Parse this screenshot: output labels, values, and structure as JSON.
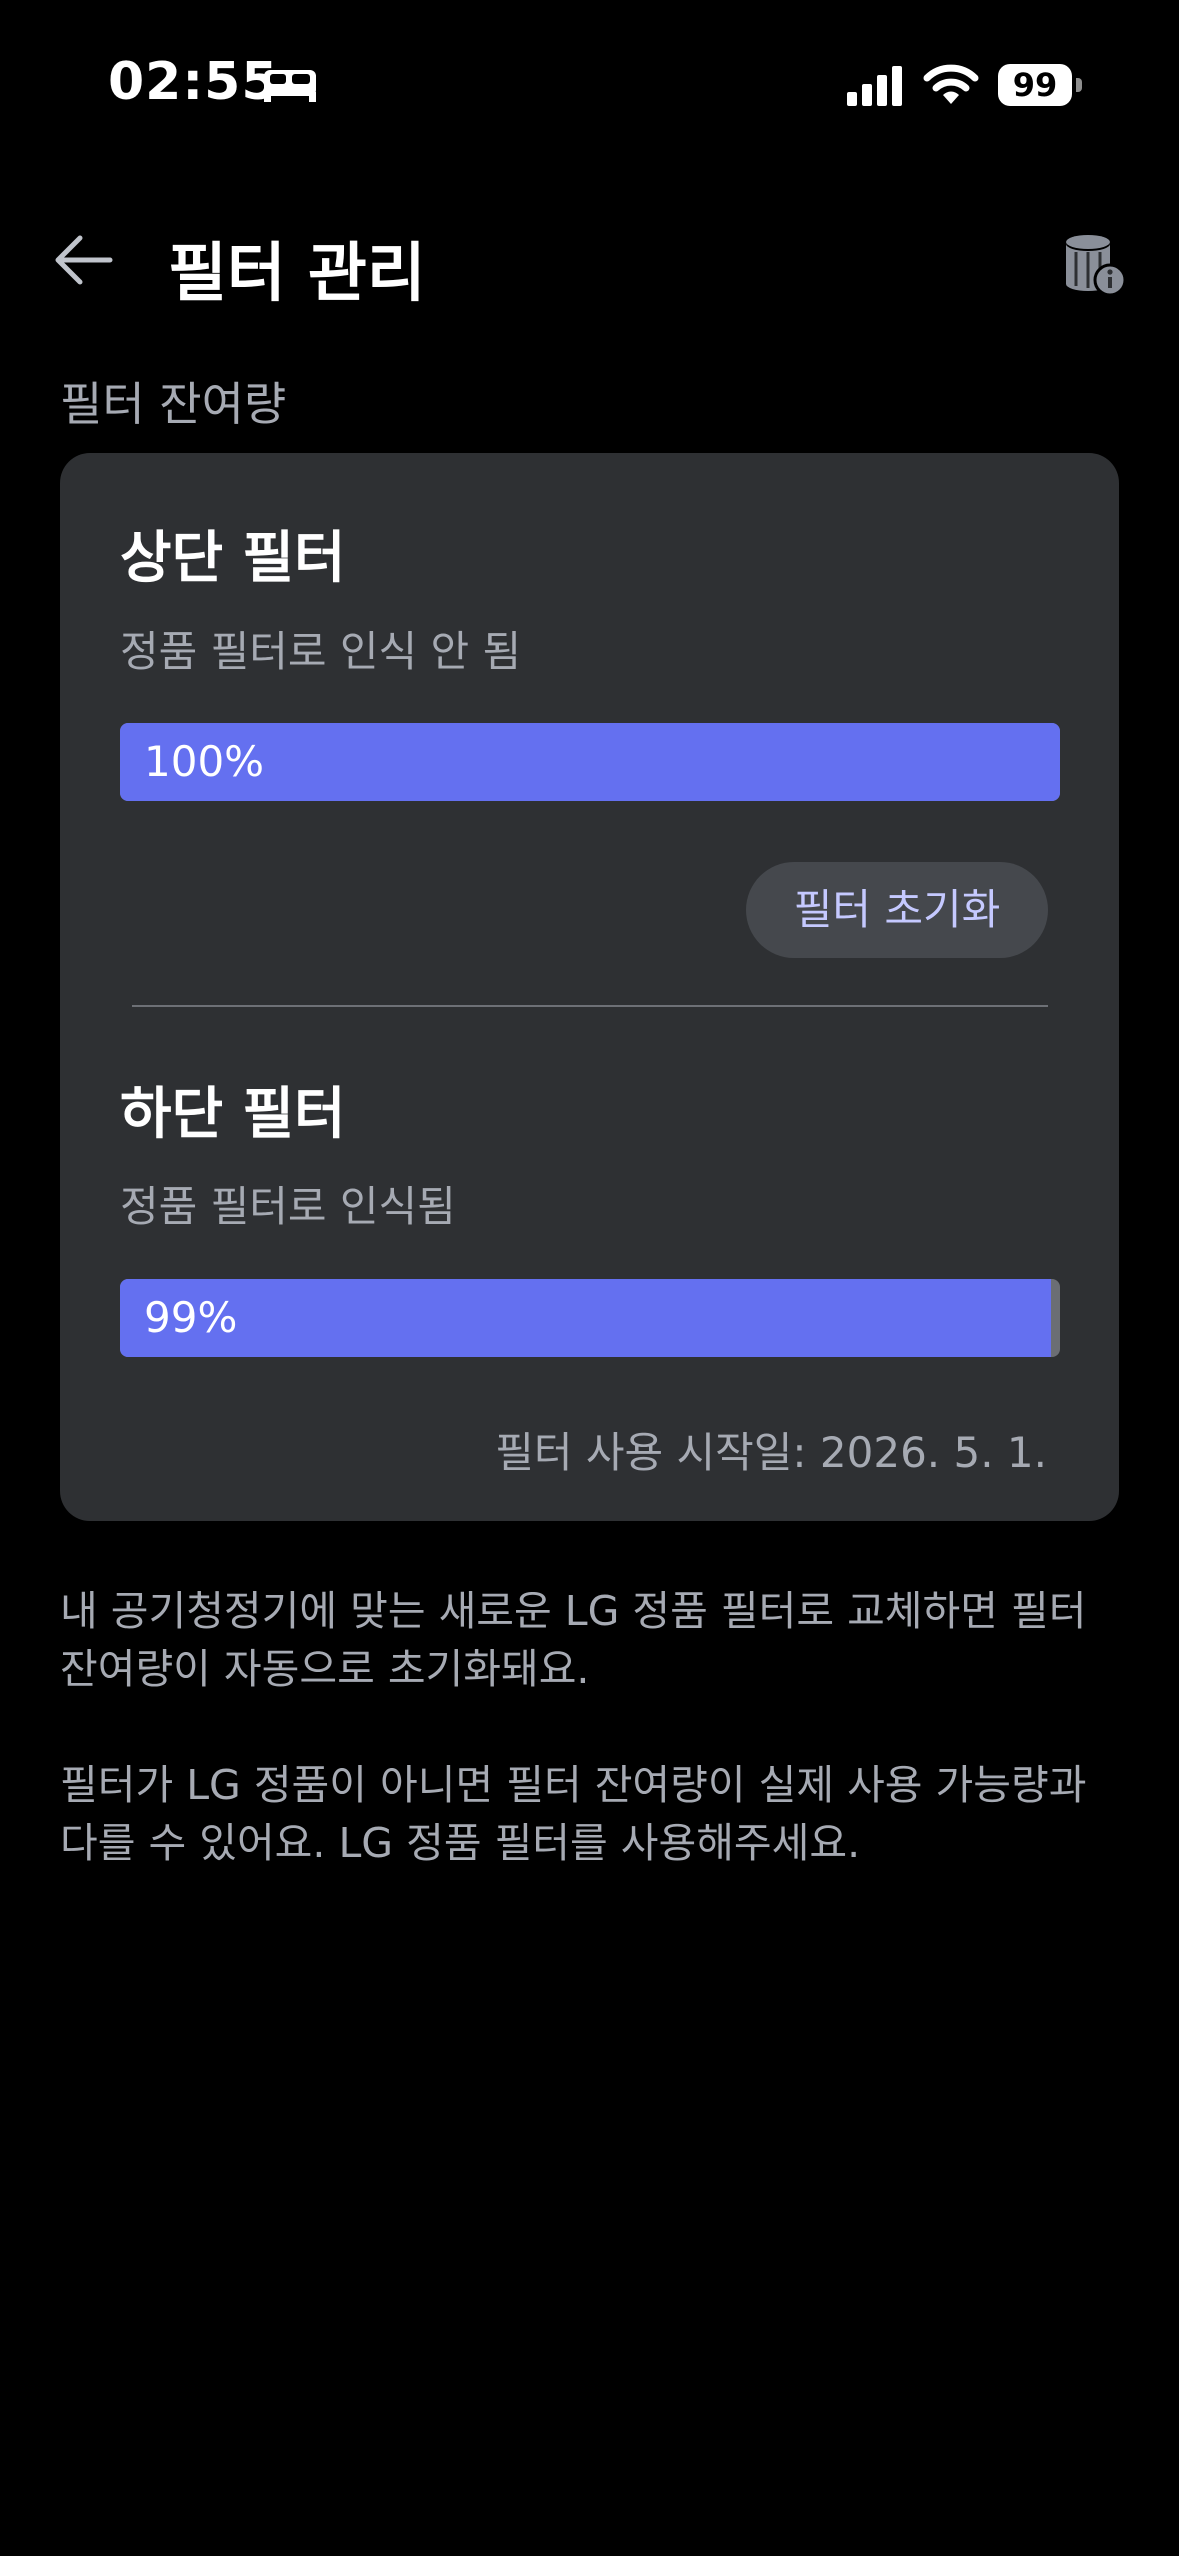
{
  "status_bar": {
    "time": "02:55",
    "battery_level": "99",
    "icons": [
      "sleep-mode-icon",
      "signal-icon",
      "wifi-icon",
      "battery-icon"
    ]
  },
  "header": {
    "back_icon": "back-arrow-icon",
    "title": "필터 관리",
    "info_icon": "filter-info-icon"
  },
  "section": {
    "label": "필터 잔여량"
  },
  "filters": [
    {
      "title": "상단 필터",
      "status": "정품 필터로 인식 안 됨",
      "percent_label": "100%",
      "remaining_fraction": 1.0,
      "reset_label": "필터 초기화"
    },
    {
      "title": "하단 필터",
      "status": "정품 필터로 인식됨",
      "percent_label": "99%",
      "remaining_fraction": 0.99,
      "start_date": "필터 사용 시작일: 2026. 5. 1."
    }
  ],
  "notes": {
    "line1": "내 공기청정기에 맞는 새로운 LG 정품 필터로 교체하면 필터 잔여량이 자동으로 초기화돼요.",
    "line2": "필터가 LG 정품이 아니면 필터 잔여량이 실제 사용 가능량과 다를 수 있어요. LG 정품 필터를 사용해주세요."
  },
  "colors": {
    "background": "#000000",
    "card": "#2e3033",
    "progress_fill": "#6470f0",
    "progress_track": "#6b6e74",
    "secondary_text": "#a6aab3",
    "button_text": "#c5c9ff"
  }
}
